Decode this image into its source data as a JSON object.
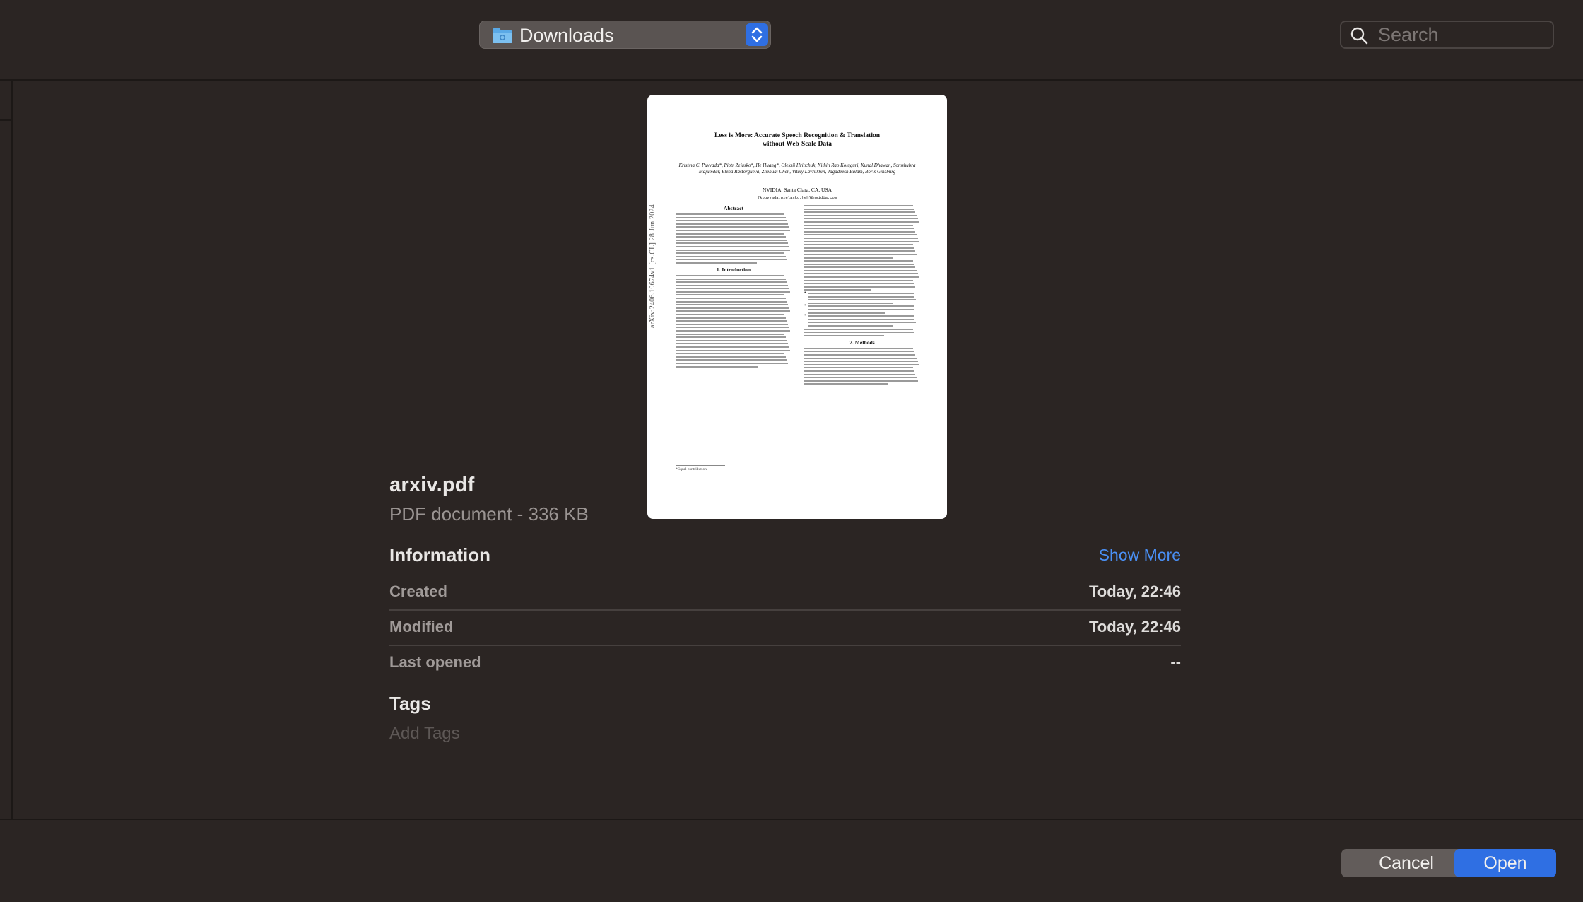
{
  "toolbar": {
    "location_label": "Downloads",
    "search_placeholder": "Search"
  },
  "preview": {
    "paper_title_line1": "Less is More: Accurate Speech Recognition & Translation",
    "paper_title_line2": "without Web-Scale Data",
    "paper_authors": "Krishna C. Puvvada*, Piotr Żelasko*, He Huang*, Oleksii Hrinchuk, Nithin Rao Koluguri, Kunal Dhawan, Somshubra Majumdar, Elena Rastorgueva, Zhehuai Chen, Vitaly Lavrukhin, Jagadeesh Balam, Boris Ginsburg",
    "paper_affiliation": "NVIDIA, Santa Clara, CA, USA",
    "paper_email": "{kpuvvada,pzelasko,heh}@nvidia.com",
    "arxiv_stamp": "arXiv:2406.19674v1  [cs.CL]  28 Jun 2024",
    "abstract_heading": "Abstract",
    "intro_heading": "1.  Introduction",
    "methods_heading": "2.  Methods",
    "footnote": "*Equal contribution"
  },
  "file": {
    "name": "arxiv.pdf",
    "kind": "PDF document - 336 KB"
  },
  "info": {
    "title": "Information",
    "show_more": "Show More",
    "rows": [
      {
        "label": "Created",
        "value": "Today, 22:46"
      },
      {
        "label": "Modified",
        "value": "Today, 22:46"
      },
      {
        "label": "Last opened",
        "value": "--"
      }
    ]
  },
  "tags": {
    "title": "Tags",
    "placeholder": "Add Tags"
  },
  "buttons": {
    "cancel": "Cancel",
    "open": "Open"
  },
  "colors": {
    "accent": "#2f6fe3",
    "link": "#4a90f5",
    "background": "#2b2523"
  }
}
